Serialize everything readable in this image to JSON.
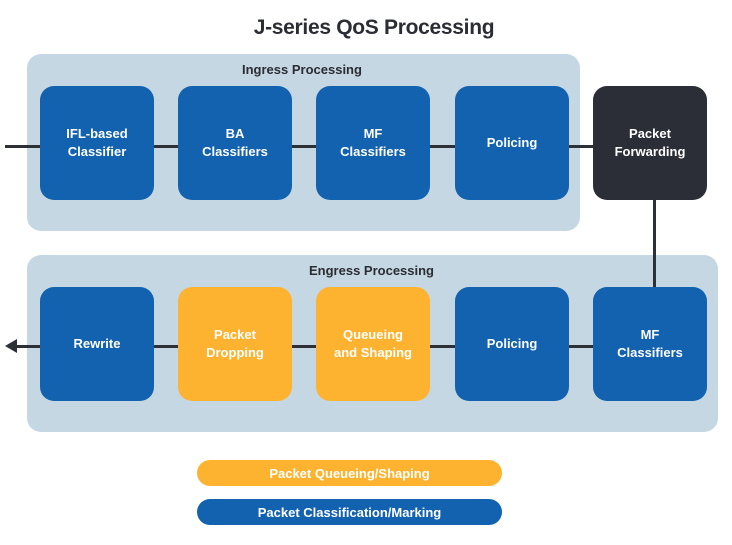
{
  "title": "J-series QoS Processing",
  "colors": {
    "panel": "#c5d7e2",
    "classification_blue": "#1262b0",
    "queueing_orange": "#fdb32f",
    "forwarding_dark": "#2b2e36",
    "connector": "#2d3036"
  },
  "ingress": {
    "label": "Ingress Processing",
    "stages": [
      {
        "label": "IFL-based\nClassifier",
        "category": "classification"
      },
      {
        "label": "BA\nClassifiers",
        "category": "classification"
      },
      {
        "label": "MF\nClassifiers",
        "category": "classification"
      },
      {
        "label": "Policing",
        "category": "classification"
      }
    ]
  },
  "forwarding": {
    "label": "Packet\nForwarding"
  },
  "egress": {
    "label": "Engress Processing",
    "stages": [
      {
        "label": "Rewrite",
        "category": "classification"
      },
      {
        "label": "Packet\nDropping",
        "category": "queueing"
      },
      {
        "label": "Queueing\nand Shaping",
        "category": "queueing"
      },
      {
        "label": "Policing",
        "category": "classification"
      },
      {
        "label": "MF\nClassifiers",
        "category": "classification"
      }
    ]
  },
  "legend": [
    {
      "label": "Packet Queueing/Shaping",
      "category": "queueing"
    },
    {
      "label": "Packet Classification/Marking",
      "category": "classification"
    }
  ]
}
